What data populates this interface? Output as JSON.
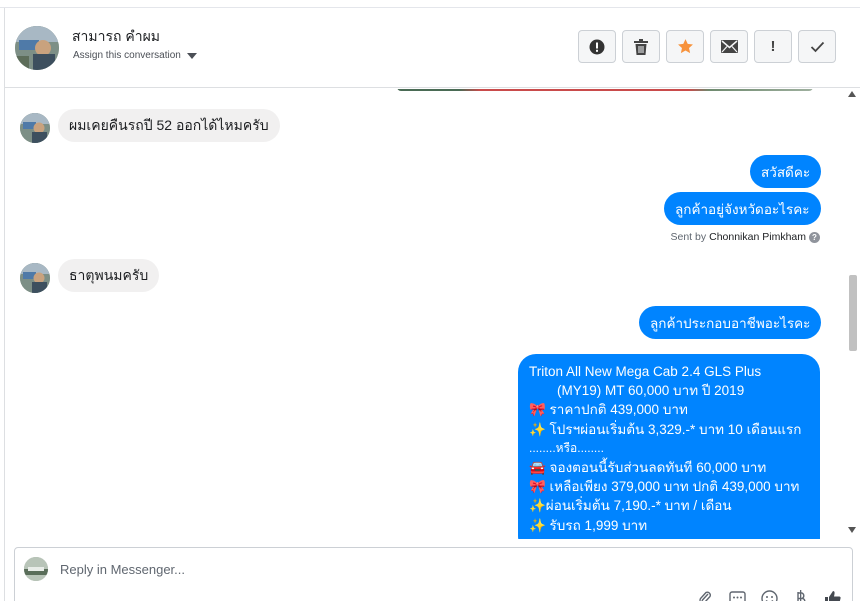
{
  "header": {
    "contact_name": "สามารถ คำผม",
    "assign_label": "Assign this conversation",
    "actions": [
      {
        "name": "spam",
        "label": "!"
      },
      {
        "name": "delete"
      },
      {
        "name": "star"
      },
      {
        "name": "mail"
      },
      {
        "name": "follow-up",
        "label": "!"
      },
      {
        "name": "done"
      }
    ]
  },
  "colors": {
    "outgoing_bubble": "#0084ff",
    "incoming_bubble": "#f1f0f0",
    "star": "#f7923b"
  },
  "messages": {
    "m1": "ผมเคยคืนรถปี 52 ออกได้ไหมครับ",
    "m2": "สวัสดีคะ",
    "m3": "ลูกค้าอยู่จังหวัดอะไรคะ",
    "sent_by_prefix": "Sent by",
    "sent_by_name": "Chonnikan Pimkham",
    "m4": "ธาตุพนมครับ",
    "m5": "ลูกค้าประกอบอาชีพอะไรคะ",
    "offer": {
      "l1": "Triton All New Mega Cab 2.4 GLS Plus",
      "l2": "(MY19) MT 60,000 บาท ปี 2019",
      "l3": "🎀 ราคาปกติ 439,000 บาท",
      "l4": "✨ โปรฯผ่อนเริ่มต้น 3,329.-* บาท 10 เดือนแรก",
      "l5": "........หรือ........",
      "l6": "🚘 จองตอนนี้รับส่วนลดทันที 60,000 บาท",
      "l7": "🎀 เหลือเพียง 379,000 บาท ปกติ 439,000 บาท",
      "l8": "✨ผ่อนเริ่มต้น 7,190.-* บาท / เดือน",
      "l9": "✨ รับรถ 1,999 บาท"
    }
  },
  "composer": {
    "placeholder": "Reply in Messenger...",
    "tools": [
      "attach-icon",
      "template-icon",
      "emoji-icon",
      "payment-icon",
      "like-icon"
    ]
  }
}
